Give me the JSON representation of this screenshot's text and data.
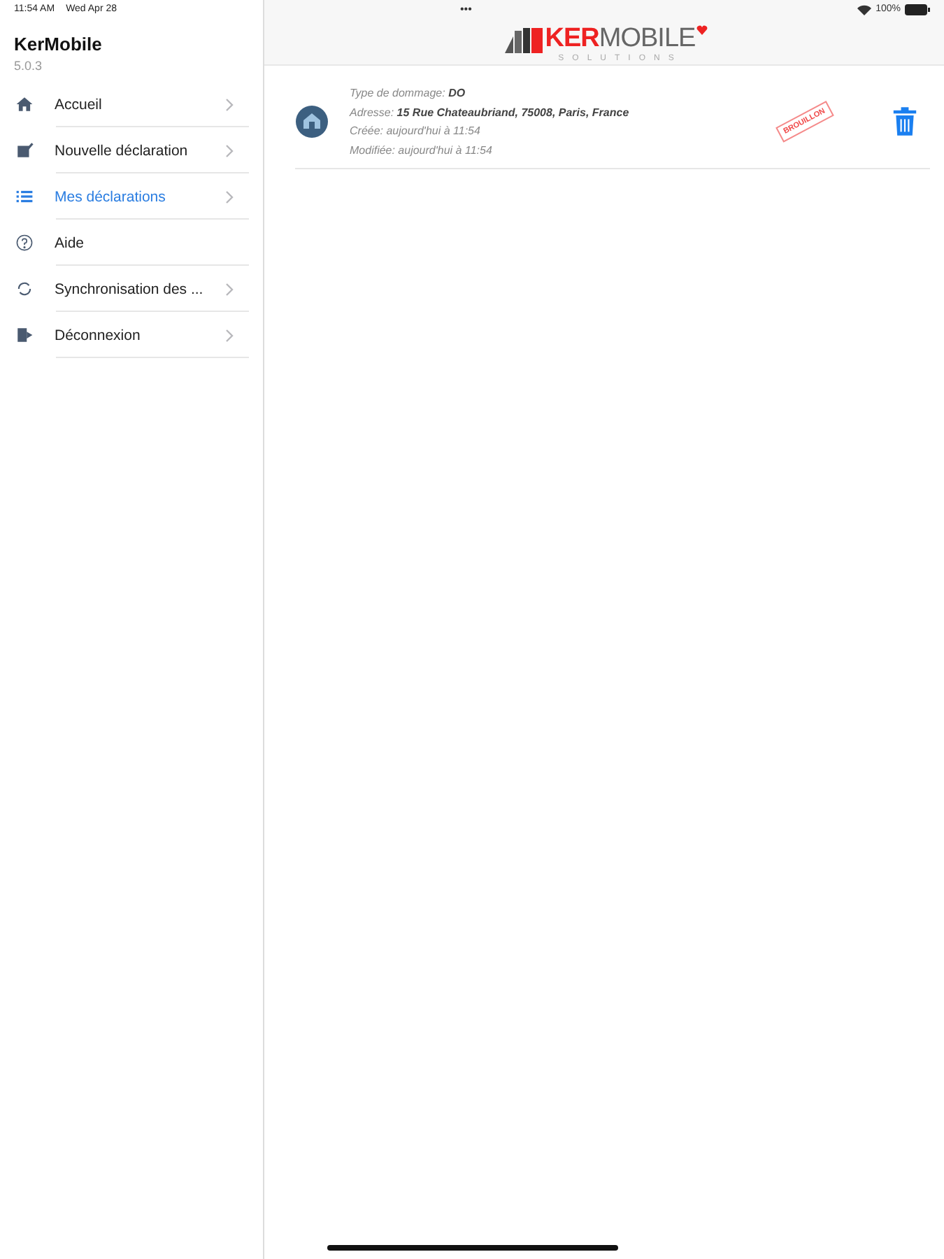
{
  "status_bar": {
    "time": "11:54 AM",
    "date": "Wed Apr 28",
    "dots": "•••",
    "battery": "100%"
  },
  "sidebar": {
    "title": "KerMobile",
    "version": "5.0.3",
    "items": [
      {
        "label": "Accueil",
        "selected": false,
        "chevron": true
      },
      {
        "label": "Nouvelle déclaration",
        "selected": false,
        "chevron": true
      },
      {
        "label": "Mes déclarations",
        "selected": true,
        "chevron": true
      },
      {
        "label": "Aide",
        "selected": false,
        "chevron": false
      },
      {
        "label": "Synchronisation des ...",
        "selected": false,
        "chevron": true
      },
      {
        "label": "Déconnexion",
        "selected": false,
        "chevron": true
      }
    ]
  },
  "logo": {
    "part_1": "KER",
    "part_2": "MOBILE",
    "tagline": "SOLUTIONS"
  },
  "declarations": [
    {
      "lines": [
        "Type de dommage: **DO**",
        "Adresse: **15 Rue Chateaubriand, 75008, Paris, France**",
        "Créée: aujourd'hui à 11:54",
        "Modifiée: aujourd'hui à 11:54"
      ],
      "stamp": "BROUILLON"
    }
  ]
}
